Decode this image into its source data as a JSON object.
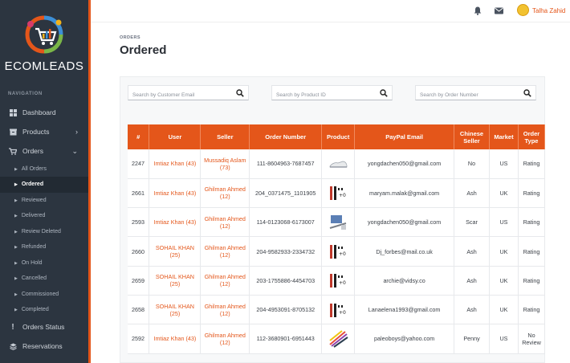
{
  "brand": {
    "name": "ECOMLEADS"
  },
  "sidebar": {
    "heading": "NAVIGATION",
    "items": [
      {
        "label": "Dashboard",
        "icon": "grid-icon"
      },
      {
        "label": "Products",
        "icon": "box-icon"
      },
      {
        "label": "Orders",
        "icon": "cart-icon"
      }
    ],
    "order_subitems": [
      {
        "label": "All Orders"
      },
      {
        "label": "Ordered"
      },
      {
        "label": "Reviewed"
      },
      {
        "label": "Delivered"
      },
      {
        "label": "Review Deleted"
      },
      {
        "label": "Refunded"
      },
      {
        "label": "On Hold"
      },
      {
        "label": "Cancelled"
      },
      {
        "label": "Commissioned"
      },
      {
        "label": "Completed"
      }
    ],
    "bottom_items": [
      {
        "label": "Orders Status",
        "icon": "exclamation-icon"
      },
      {
        "label": "Reservations",
        "icon": "layers-icon"
      }
    ]
  },
  "header": {
    "user_name": "Talha Zahid"
  },
  "page": {
    "breadcrumb": "ORDERS",
    "title": "Ordered"
  },
  "filters": {
    "customer_email_placeholder": "Search by Customer Email",
    "product_id_placeholder": "Search by Product ID",
    "order_number_placeholder": "Search by Order Number"
  },
  "table": {
    "headers": [
      "#",
      "User",
      "Seller",
      "Order Number",
      "Product",
      "PayPal Email",
      "Chinese Seller",
      "Market",
      "Order Type"
    ],
    "rows": [
      {
        "id": "2247",
        "user": "Imtiaz Khan (43)",
        "seller": "Mussadiq Aslam (73)",
        "order_number": "111-8604963-7687457",
        "product_icon": "shoe-product-thumbnail",
        "paypal": "yongdachen050@gmail.com",
        "chinese_seller": "No",
        "market": "US",
        "order_type": "Rating"
      },
      {
        "id": "2661",
        "user": "Imtiaz Khan (43)",
        "seller": "Ghilman Ahmed (12)",
        "order_number": "204_0371475_1101905",
        "product_icon": "pens-product-thumbnail",
        "paypal": "maryam.malak@gmail.com",
        "chinese_seller": "Ash",
        "market": "UK",
        "order_type": "Rating"
      },
      {
        "id": "2593",
        "user": "Imtiaz Khan (43)",
        "seller": "Ghilman Ahmed (12)",
        "order_number": "114-0123068-6173007",
        "product_icon": "device-product-thumbnail",
        "paypal": "yongdachen050@gmail.com",
        "chinese_seller": "Scar",
        "market": "US",
        "order_type": "Rating"
      },
      {
        "id": "2660",
        "user": "SOHAIL KHAN (25)",
        "seller": "Ghilman Ahmed (12)",
        "order_number": "204-9582933-2334732",
        "product_icon": "pens-product-thumbnail",
        "paypal": "Dj_forbes@mail.co.uk",
        "chinese_seller": "Ash",
        "market": "UK",
        "order_type": "Rating"
      },
      {
        "id": "2659",
        "user": "SOHAIL KHAN (25)",
        "seller": "Ghilman Ahmed (12)",
        "order_number": "203-1755886-4454703",
        "product_icon": "pens-product-thumbnail",
        "paypal": "archie@vidsy.co",
        "chinese_seller": "Ash",
        "market": "UK",
        "order_type": "Rating"
      },
      {
        "id": "2658",
        "user": "SOHAIL KHAN (25)",
        "seller": "Ghilman Ahmed (12)",
        "order_number": "204-4953091-8705132",
        "product_icon": "pens-product-thumbnail",
        "paypal": "Lanaelena1993@gmail.com",
        "chinese_seller": "Ash",
        "market": "UK",
        "order_type": "Rating"
      },
      {
        "id": "2592",
        "user": "Imtiaz Khan (43)",
        "seller": "Ghilman Ahmed (12)",
        "order_number": "112-3680901-6951443",
        "product_icon": "markers-product-thumbnail",
        "paypal": "paleoboys@yahoo.com",
        "chinese_seller": "Penny",
        "market": "US",
        "order_type": "No Review"
      }
    ]
  },
  "colors": {
    "accent": "#e4561a",
    "sidebar_bg": "#2c3540",
    "header_bg": "#e4561a"
  }
}
